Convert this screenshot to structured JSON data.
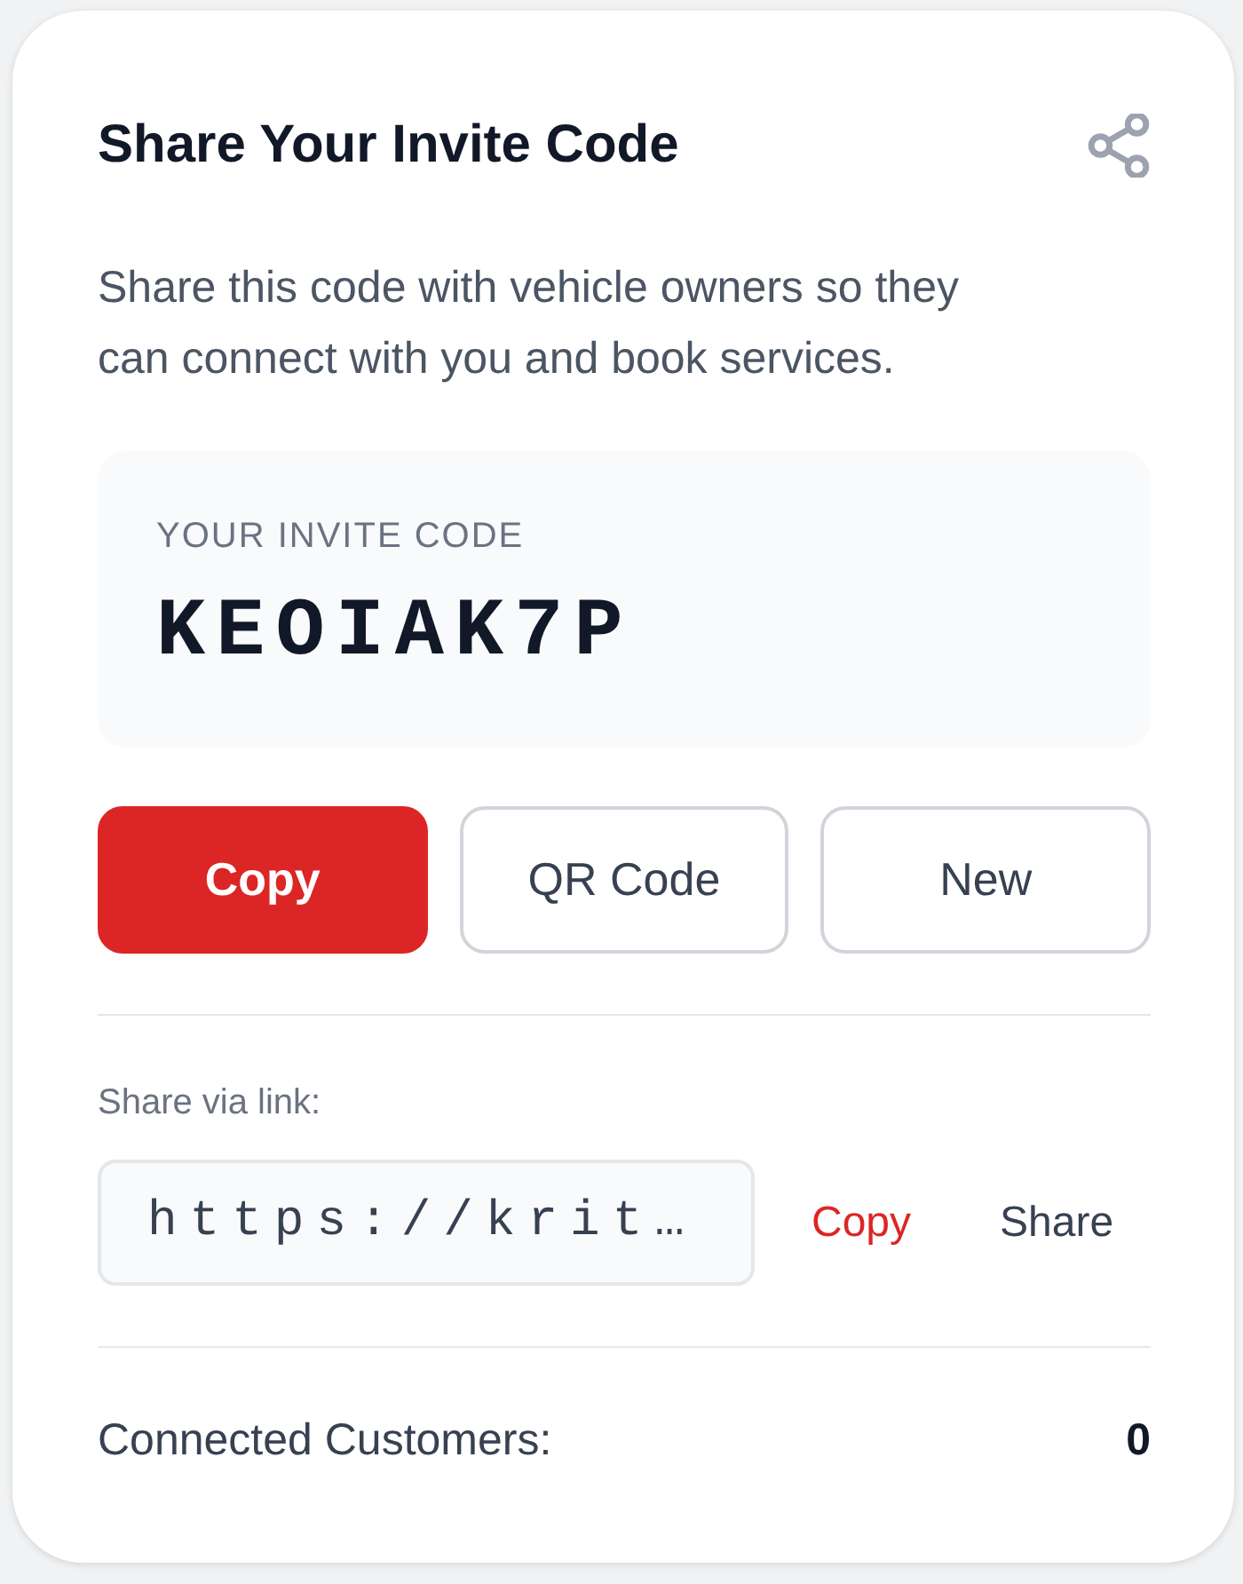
{
  "card": {
    "title": "Share Your Invite Code",
    "description": "Share this code with vehicle owners so they can connect with you and book services.",
    "invite_code": {
      "label": "YOUR INVITE CODE",
      "code": "KEOIAK7P"
    },
    "actions": [
      {
        "label": "Copy",
        "kind": "primary"
      },
      {
        "label": "QR Code",
        "kind": "outline"
      },
      {
        "label": "New",
        "kind": "outline"
      }
    ],
    "link": {
      "label": "Share via link:",
      "value": "https://krit…",
      "actions": [
        {
          "label": "Copy",
          "kind": "accent"
        },
        {
          "label": "Share",
          "kind": "plain"
        }
      ]
    },
    "stats": {
      "label": "Connected Customers:",
      "value": "0"
    }
  }
}
